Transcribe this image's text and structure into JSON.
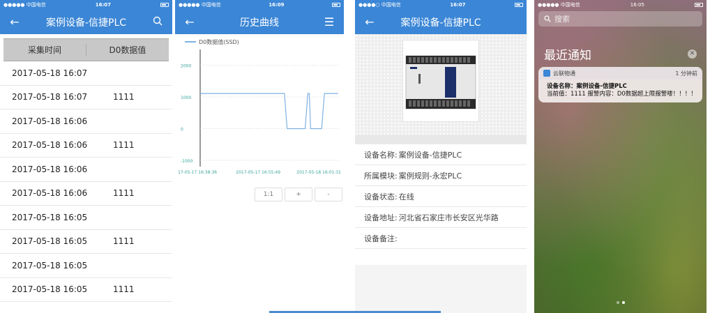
{
  "s1": {
    "status": {
      "carrier": "●●●●● 中国电信",
      "time": "16:07"
    },
    "nav": {
      "back": "←",
      "title": "案例设备-信捷PLC",
      "search": "🔍"
    },
    "table": {
      "headers": [
        "采集时间",
        "D0数据值"
      ],
      "rows": [
        {
          "time": "2017-05-18 16:07",
          "value": ""
        },
        {
          "time": "2017-05-18 16:07",
          "value": "1111"
        },
        {
          "time": "2017-05-18 16:06",
          "value": ""
        },
        {
          "time": "2017-05-18 16:06",
          "value": "1111"
        },
        {
          "time": "2017-05-18 16:06",
          "value": ""
        },
        {
          "time": "2017-05-18 16:06",
          "value": "1111"
        },
        {
          "time": "2017-05-18 16:05",
          "value": ""
        },
        {
          "time": "2017-05-18 16:05",
          "value": "1111"
        },
        {
          "time": "2017-05-18 16:05",
          "value": ""
        },
        {
          "time": "2017-05-18 16:05",
          "value": "1111"
        }
      ]
    }
  },
  "s2": {
    "status": {
      "carrier": "●●●●● 中国电信",
      "time": "16:09"
    },
    "nav": {
      "back": "←",
      "title": "历史曲线",
      "menu": "☰"
    },
    "zoom": {
      "reset": "1:1",
      "plus": "+",
      "minus": "-"
    }
  },
  "chart_data": {
    "type": "line",
    "title": "",
    "legend": "D0数据值(SSD)",
    "ylim": [
      -1200,
      2500
    ],
    "yticks": [
      2000,
      1000,
      0,
      -1000
    ],
    "xtick_labels": [
      "17-05-17 16:38:36",
      "2017-05-17 16:55:49",
      "2017-05-18 16:01:31"
    ],
    "series": [
      {
        "name": "D0数据值(SSD)",
        "points": [
          [
            0,
            1111
          ],
          [
            0.61,
            1111
          ],
          [
            0.63,
            0
          ],
          [
            0.76,
            0
          ],
          [
            0.78,
            1111
          ],
          [
            0.79,
            1111
          ],
          [
            0.8,
            0
          ],
          [
            0.88,
            0
          ],
          [
            0.9,
            1111
          ],
          [
            1,
            1111
          ]
        ]
      }
    ]
  },
  "s3": {
    "status": {
      "carrier": "●●●●○ 中国电信",
      "time": "16:07"
    },
    "nav": {
      "back": "←",
      "title": "案例设备-信捷PLC"
    },
    "details": [
      {
        "label": "设备名称:",
        "value": "案例设备-信捷PLC"
      },
      {
        "label": "所属模块:",
        "value": "案例规则-永宏PLC"
      },
      {
        "label": "设备状态:",
        "value": "在线"
      },
      {
        "label": "设备地址:",
        "value": "河北省石家庄市长安区光华路"
      },
      {
        "label": "设备备注:",
        "value": ""
      }
    ]
  },
  "s4": {
    "status": {
      "carrier": "●●●●● 中国电信",
      "time": "16:05"
    },
    "search_placeholder": "搜索",
    "recent_title": "最近通知",
    "clear": "✕",
    "notification": {
      "app": "云联物通",
      "ago": "1 分钟前",
      "title": "设备名称：案例设备-信捷PLC",
      "body": "当前值：1111 报警内容：D0数据超上限报警喽！！！！"
    }
  }
}
